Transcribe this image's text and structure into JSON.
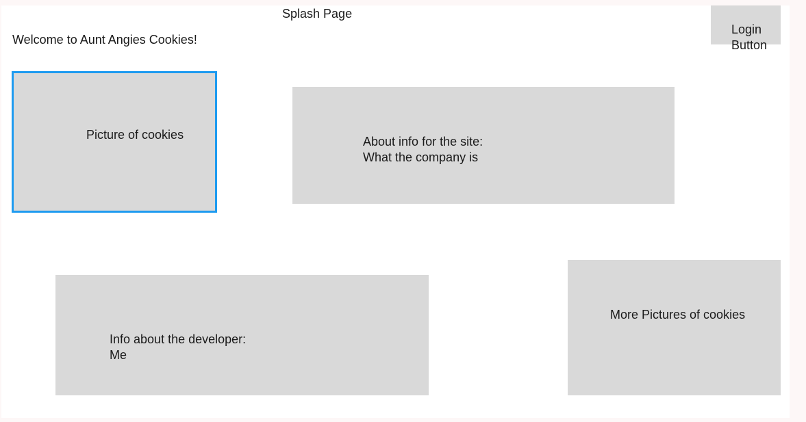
{
  "header": {
    "page_title": "Splash Page",
    "welcome": "Welcome to Aunt Angies Cookies!",
    "login_button": "Login Button"
  },
  "sections": {
    "cookie_picture": "Picture of cookies",
    "about": {
      "line1": "About info for the site:",
      "line2": "What the company is"
    },
    "developer": {
      "line1": "Info about the developer:",
      "line2": "Me"
    },
    "more_pictures": "More Pictures of cookies"
  },
  "colors": {
    "placeholder_fill": "#d9d9d9",
    "selection_border": "#1e9bf0",
    "canvas_background": "#ffffff"
  }
}
